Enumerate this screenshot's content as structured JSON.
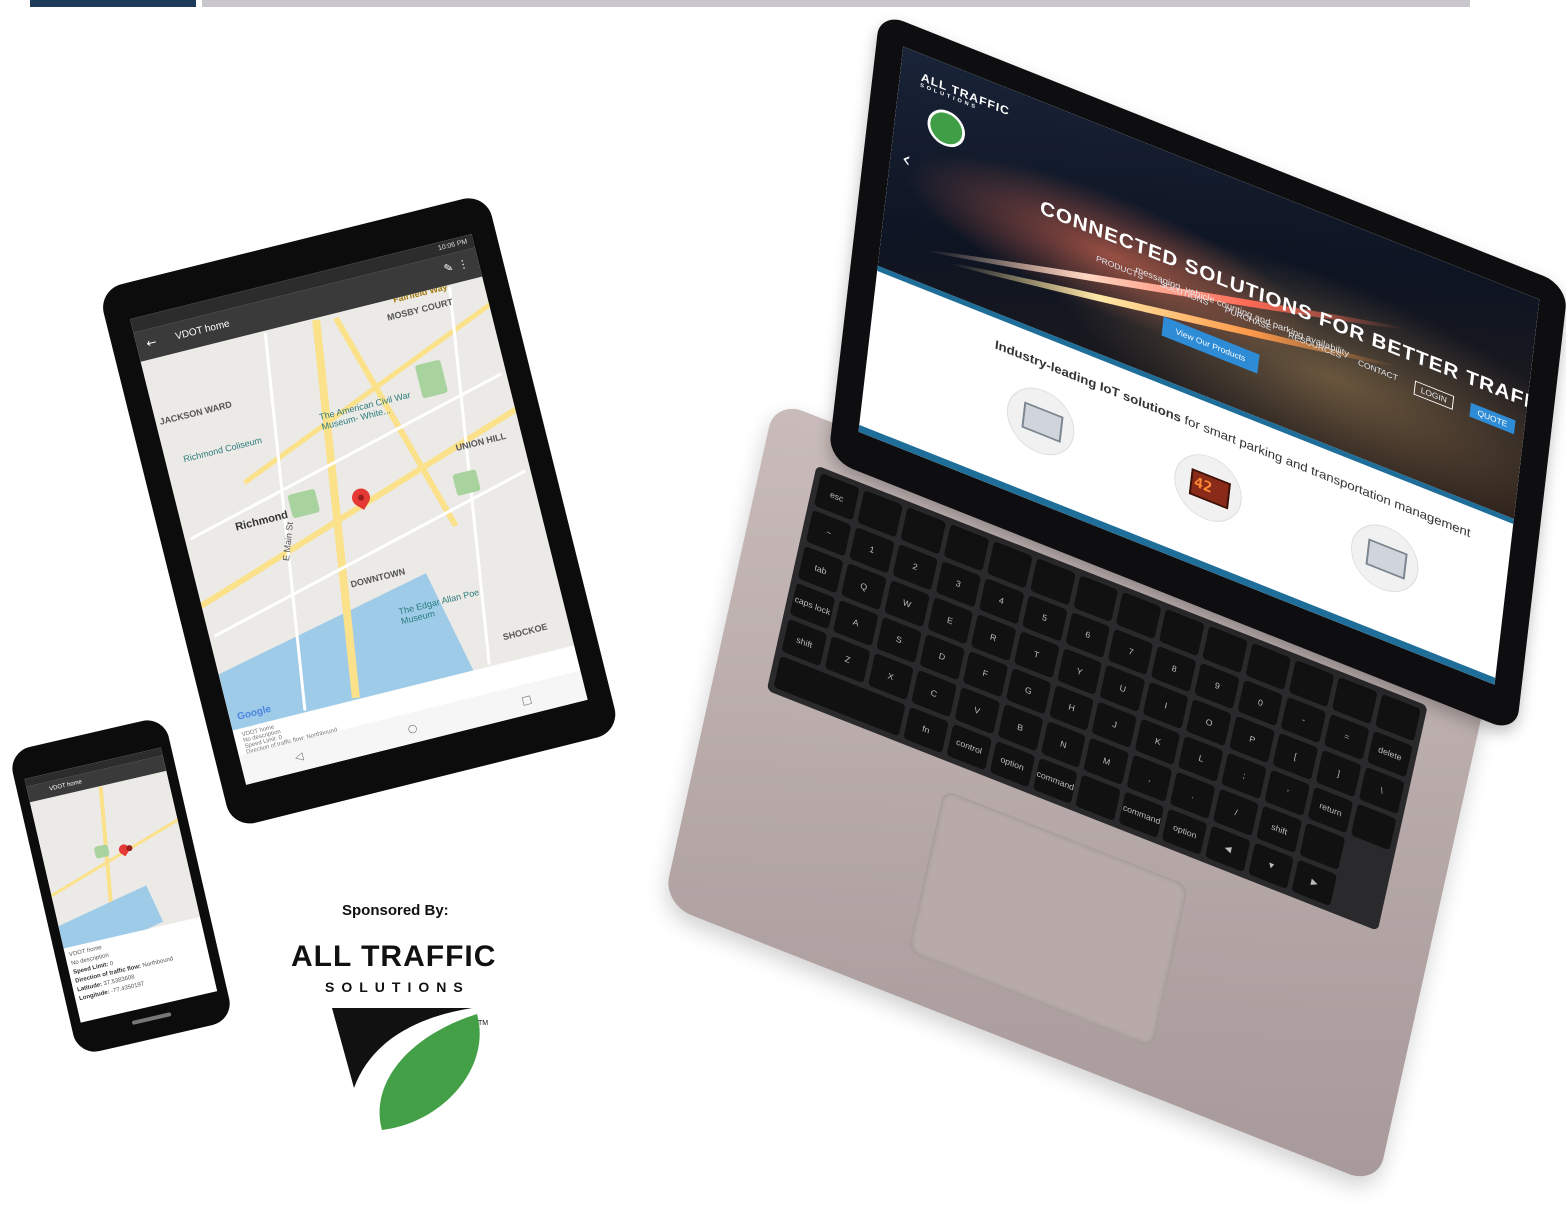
{
  "laptop_site": {
    "logo": "ALL TRAFFIC",
    "logo_sub": "SOLUTIONS",
    "headline": "CONNECTED SOLUTIONS FOR BETTER TRAFFIC SAFETY OUTCOMES",
    "subheadline": "messaging, vehicle counting and parking availability",
    "cta": "View Our Products",
    "nav": [
      "PRODUCTS",
      "SOLUTIONS",
      "PURCHASE",
      "RESOURCES",
      "CONTACT"
    ],
    "login": "LOGIN",
    "quote": "QUOTE",
    "tagline_bold": "Industry-leading IoT solutions",
    "tagline_rest": " for smart parking and transportation management",
    "sign_digits": "42"
  },
  "keyboard": {
    "keys": [
      "esc",
      "",
      "",
      "",
      "",
      "",
      "",
      "",
      "",
      "",
      "",
      "",
      "",
      "",
      "~",
      "1",
      "2",
      "3",
      "4",
      "5",
      "6",
      "7",
      "8",
      "9",
      "0",
      "-",
      "=",
      "delete",
      "tab",
      "Q",
      "W",
      "E",
      "R",
      "T",
      "Y",
      "U",
      "I",
      "O",
      "P",
      "[",
      "]",
      "\\",
      "caps lock",
      "A",
      "S",
      "D",
      "F",
      "G",
      "H",
      "J",
      "K",
      "L",
      ";",
      "'",
      "return",
      "",
      "shift",
      "Z",
      "X",
      "C",
      "V",
      "B",
      "N",
      "M",
      ",",
      ".",
      "/",
      "shift",
      "",
      "",
      "fn",
      "control",
      "option",
      "command",
      "",
      "command",
      "option",
      "◀",
      "▼",
      "▶"
    ]
  },
  "tablet": {
    "app_title": "VDOT home",
    "status": "10:06 PM",
    "map_labels": {
      "jackson_ward": "JACKSON WARD",
      "mosby": "MOSBY COURT",
      "coliseum": "Richmond Coliseum",
      "museum": "The American Civil War Museum- White...",
      "richmond": "Richmond",
      "union_hill": "UNION HILL",
      "downtown": "DOWNTOWN",
      "poe": "The Edgar Allan Poe Museum",
      "shockoe": "SHOCKOE",
      "fairfield": "Fairfield Way",
      "main_st": "E Main St"
    },
    "google": "Google",
    "info_lines": [
      "VDOT home",
      "No description",
      "Speed Limit: 0",
      "Direction of traffic flow: Northbound",
      "Latitude: 37.5383",
      "Longitude: -77.4350"
    ]
  },
  "phone": {
    "app_title": "VDOT home",
    "info_title": "VDOT home",
    "info_desc": "No description",
    "info_rows": [
      {
        "label": "Speed Limit:",
        "value": "0"
      },
      {
        "label": "Direction of traffic flow:",
        "value": "Northbound"
      },
      {
        "label": "Latitude:",
        "value": "37.5383608"
      },
      {
        "label": "Longitude:",
        "value": "-77.4350197"
      }
    ]
  },
  "sponsor": {
    "label": "Sponsored By:",
    "name": "ALL TRAFFIC",
    "sub": "SOLUTIONS",
    "tm": "TM",
    "colors": {
      "green": "#43a047",
      "black": "#111111"
    }
  },
  "colors": {
    "navy": "#1f3b5a",
    "site_blue": "#2e8bd6",
    "band": "#1f6e99"
  }
}
